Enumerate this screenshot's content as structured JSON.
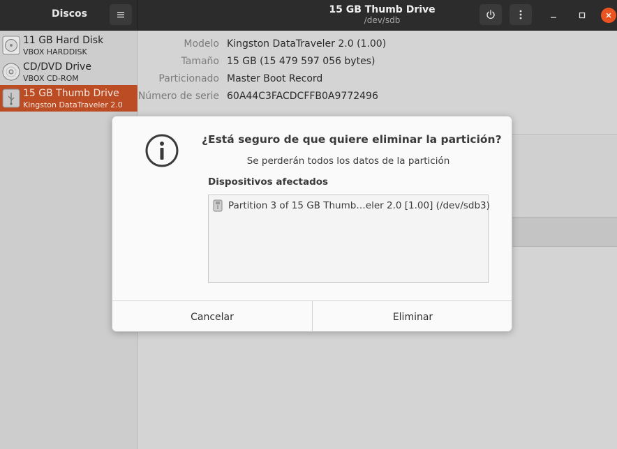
{
  "header": {
    "app_title": "Discos",
    "window_title": "15 GB Thumb Drive",
    "window_subtitle": "/dev/sdb"
  },
  "sidebar": {
    "drives": [
      {
        "name": "11 GB Hard Disk",
        "subtitle": "VBOX HARDDISK",
        "icon": "hard-disk-icon",
        "selected": false
      },
      {
        "name": "CD/DVD Drive",
        "subtitle": "VBOX CD-ROM",
        "icon": "optical-disc-icon",
        "selected": false
      },
      {
        "name": "15 GB Thumb Drive",
        "subtitle": "Kingston DataTraveler 2.0",
        "icon": "usb-drive-icon",
        "selected": true
      }
    ]
  },
  "details": {
    "model_label": "Modelo",
    "model_value": "Kingston DataTraveler 2.0 (1.00)",
    "size_label": "Tamaño",
    "size_value": "15 GB (15 479 597 056 bytes)",
    "partitioning_label": "Particionado",
    "partitioning_value": "Master Boot Record",
    "serial_label": "Número de serie",
    "serial_value": "60A44C3FACDCFFB0A9772496"
  },
  "dialog": {
    "icon": "info-icon",
    "title": "¿Está seguro de que quiere eliminar la partición?",
    "message": "Se perderán todos los datos de la partición",
    "section_label": "Dispositivos afectados",
    "devices": [
      {
        "label": "Partition 3 of 15 GB Thumb…eler 2.0 [1.00] (/dev/sdb3)",
        "icon": "usb-drive-icon"
      }
    ],
    "cancel_label": "Cancelar",
    "confirm_label": "Eliminar"
  },
  "colors": {
    "accent": "#bb4c24",
    "close_button": "#e95420",
    "headerbar": "#2c2c2c"
  }
}
